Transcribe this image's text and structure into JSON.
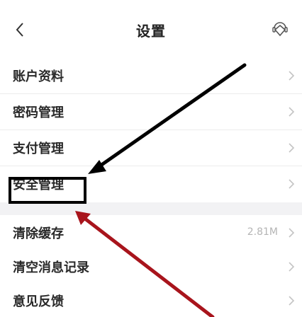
{
  "header": {
    "title": "设置",
    "back_icon": "chevron-left-icon",
    "service_icon": "customer-service-icon"
  },
  "groups": [
    {
      "items": [
        {
          "label": "账户资料"
        },
        {
          "label": "密码管理"
        },
        {
          "label": "支付管理"
        },
        {
          "label": "安全管理"
        }
      ]
    },
    {
      "items": [
        {
          "label": "清除缓存",
          "value": "2.81M"
        },
        {
          "label": "清空消息记录"
        },
        {
          "label": "意见反馈"
        }
      ]
    }
  ],
  "colors": {
    "highlight_box": "#000000",
    "arrow_black": "#000000",
    "arrow_red": "#a8141c"
  }
}
